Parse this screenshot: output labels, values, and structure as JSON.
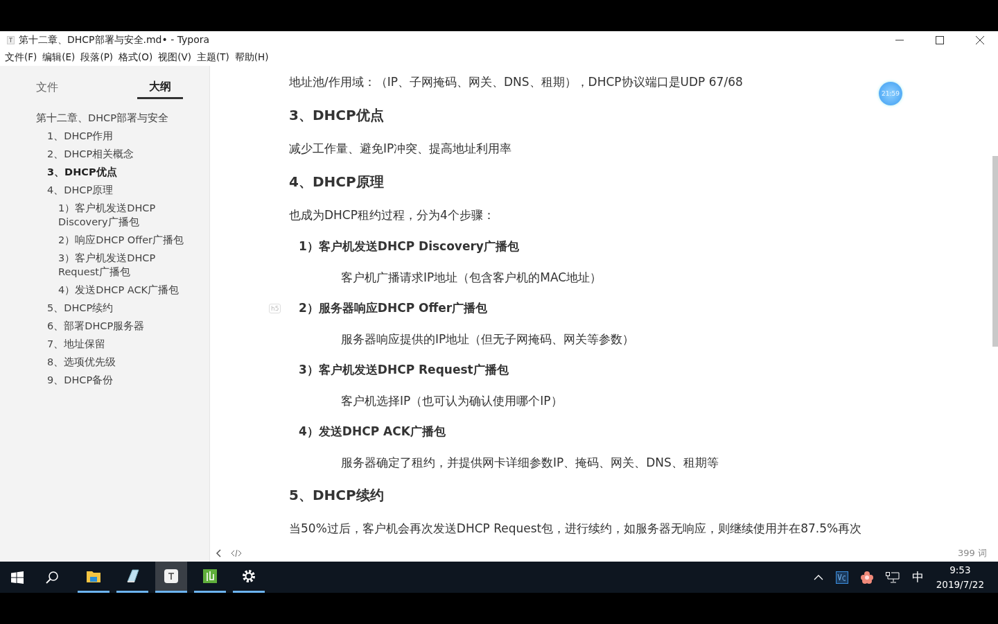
{
  "window": {
    "title": "第十二章、DHCP部署与安全.md• - Typora"
  },
  "menu": [
    "文件(F)",
    "编辑(E)",
    "段落(P)",
    "格式(O)",
    "视图(V)",
    "主题(T)",
    "帮助(H)"
  ],
  "sidebar": {
    "tabs": [
      {
        "label": "文件",
        "selected": false
      },
      {
        "label": "大纲",
        "selected": true
      }
    ],
    "outline": [
      {
        "label": "第十二章、DHCP部署与安全",
        "selected": false,
        "children": [
          {
            "label": "1、DHCP作用",
            "selected": false
          },
          {
            "label": "2、DHCP相关概念",
            "selected": false
          },
          {
            "label": "3、DHCP优点",
            "selected": true
          },
          {
            "label": "4、DHCP原理",
            "selected": false,
            "children": [
              {
                "label": "1）客户机发送DHCP Discovery广播包",
                "selected": false
              },
              {
                "label": "2）响应DHCP Offer广播包",
                "selected": false
              },
              {
                "label": "3）客户机发送DHCP Request广播包",
                "selected": false
              },
              {
                "label": "4）发送DHCP ACK广播包",
                "selected": false
              }
            ]
          },
          {
            "label": "5、DHCP续约",
            "selected": false
          },
          {
            "label": "6、部署DHCP服务器",
            "selected": false
          },
          {
            "label": "7、地址保留",
            "selected": false
          },
          {
            "label": "8、选项优先级",
            "selected": false
          },
          {
            "label": "9、DHCP备份",
            "selected": false
          }
        ]
      }
    ]
  },
  "document": {
    "blocks": [
      {
        "kind": "paragraph",
        "text": "地址池/作用域：（IP、子网掩码、网关、DNS、租期），DHCP协议端口是UDP 67/68"
      },
      {
        "kind": "h3",
        "text": "3、DHCP优点"
      },
      {
        "kind": "paragraph",
        "text": "减少工作量、避免IP冲突、提高地址利用率"
      },
      {
        "kind": "h3",
        "text": "4、DHCP原理"
      },
      {
        "kind": "paragraph",
        "text": "也成为DHCP租约过程，分为4个步骤："
      },
      {
        "kind": "h5",
        "text": "1）客户机发送DHCP Discovery广播包"
      },
      {
        "kind": "indented",
        "text": "客户机广播请求IP地址（包含客户机的MAC地址）"
      },
      {
        "kind": "h5",
        "text": "2）服务器响应DHCP Offer广播包",
        "focus_tag": "h5"
      },
      {
        "kind": "indented",
        "text": "服务器响应提供的IP地址（但无子网掩码、网关等参数）"
      },
      {
        "kind": "h5",
        "text": "3）客户机发送DHCP Request广播包"
      },
      {
        "kind": "indented",
        "text": "客户机选择IP（也可认为确认使用哪个IP）"
      },
      {
        "kind": "h5",
        "text": "4）发送DHCP ACK广播包"
      },
      {
        "kind": "indented",
        "text": "服务器确定了租约，并提供网卡详细参数IP、掩码、网关、DNS、租期等"
      },
      {
        "kind": "h3",
        "text": "5、DHCP续约"
      },
      {
        "kind": "paragraph",
        "text": "当50%过后，客户机会再次发送DHCP Request包，进行续约，如服务器无响应，则继续使用并在87.5%再次"
      }
    ],
    "timer": "21:59",
    "word_count": "399 词"
  },
  "taskbar": {
    "apps": [
      {
        "kind": "folder",
        "selected": false
      },
      {
        "kind": "notepad",
        "selected": false
      },
      {
        "kind": "typora",
        "selected": true
      },
      {
        "kind": "green",
        "selected": false
      },
      {
        "kind": "gear",
        "selected": false
      }
    ],
    "tray_ime": "中",
    "time": "9:53",
    "date": "2019/7/22"
  }
}
